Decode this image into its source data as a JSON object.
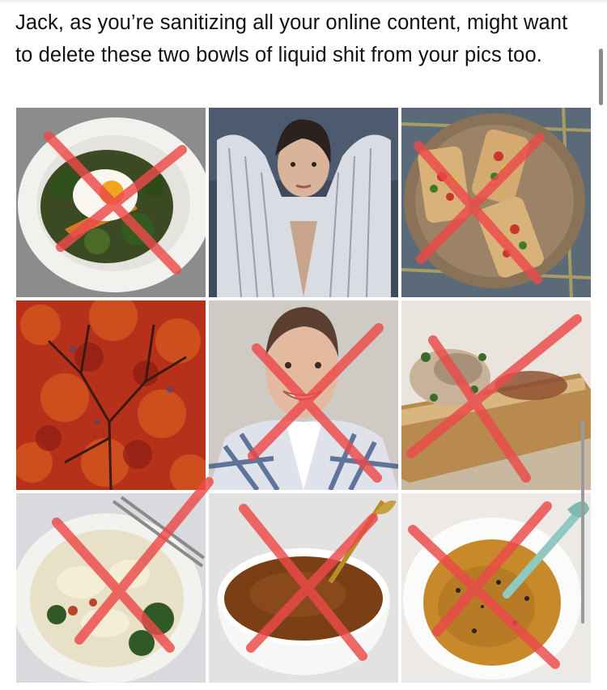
{
  "post": {
    "text": "Jack, as you’re sanitizing all your online content, might want to delete these two bowls of liquid shit from your pics too."
  },
  "photo_grid": {
    "tiles": [
      {
        "subject": "egg-and-broccoli-bowl",
        "crossed_out": true
      },
      {
        "subject": "woman-in-striped-shirt",
        "crossed_out": false
      },
      {
        "subject": "bruschetta-plate",
        "crossed_out": true
      },
      {
        "subject": "red-autumn-tree",
        "crossed_out": false
      },
      {
        "subject": "smiling-woman-plaid-shirt",
        "crossed_out": true
      },
      {
        "subject": "toast-with-fish",
        "crossed_out": true
      },
      {
        "subject": "pasta-with-broccoli",
        "crossed_out": true
      },
      {
        "subject": "brown-soup-bowl",
        "crossed_out": true
      },
      {
        "subject": "spiced-grain-bowl",
        "crossed_out": true
      }
    ]
  },
  "colors": {
    "cross": "#ec4a4a",
    "text": "#111111"
  }
}
